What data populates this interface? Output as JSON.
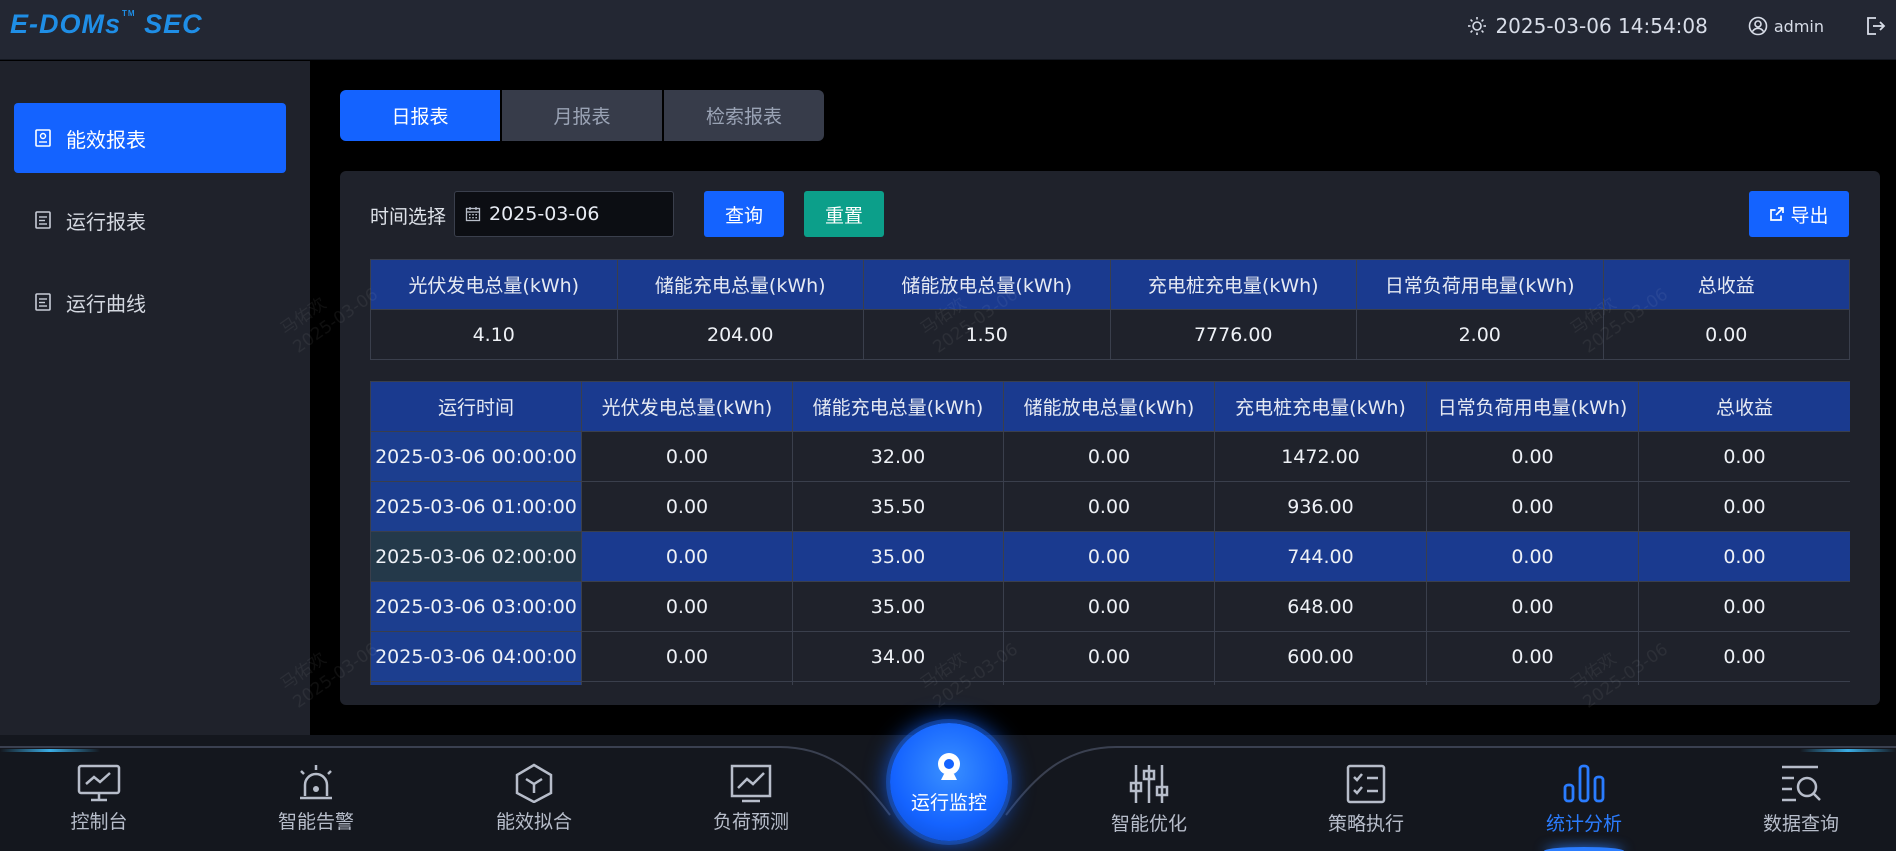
{
  "header": {
    "logo": "E-DOMs",
    "logo_tm": "TM",
    "logo_suffix": "SEC",
    "datetime": "2025-03-06 14:54:08",
    "user": "admin"
  },
  "sidebar": {
    "items": [
      {
        "label": "能效报表"
      },
      {
        "label": "运行报表"
      },
      {
        "label": "运行曲线"
      }
    ]
  },
  "tabs": [
    {
      "label": "日报表"
    },
    {
      "label": "月报表"
    },
    {
      "label": "检索报表"
    }
  ],
  "filter": {
    "label": "时间选择",
    "date_value": "2025-03-06",
    "query_label": "查询",
    "reset_label": "重置",
    "export_label": "导出"
  },
  "summary_table": {
    "headers": [
      "光伏发电总量(kWh)",
      "储能充电总量(kWh)",
      "储能放电总量(kWh)",
      "充电桩充电量(kWh)",
      "日常负荷用电量(kWh)",
      "总收益"
    ],
    "values": [
      "4.10",
      "204.00",
      "1.50",
      "7776.00",
      "2.00",
      "0.00"
    ]
  },
  "detail_table": {
    "headers": [
      "运行时间",
      "光伏发电总量(kWh)",
      "储能充电总量(kWh)",
      "储能放电总量(kWh)",
      "充电桩充电量(kWh)",
      "日常负荷用电量(kWh)",
      "总收益"
    ],
    "rows": [
      [
        "2025-03-06 00:00:00",
        "0.00",
        "32.00",
        "0.00",
        "1472.00",
        "0.00",
        "0.00"
      ],
      [
        "2025-03-06 01:00:00",
        "0.00",
        "35.50",
        "0.00",
        "936.00",
        "0.00",
        "0.00"
      ],
      [
        "2025-03-06 02:00:00",
        "0.00",
        "35.00",
        "0.00",
        "744.00",
        "0.00",
        "0.00"
      ],
      [
        "2025-03-06 03:00:00",
        "0.00",
        "35.00",
        "0.00",
        "648.00",
        "0.00",
        "0.00"
      ],
      [
        "2025-03-06 04:00:00",
        "0.00",
        "34.00",
        "0.00",
        "600.00",
        "0.00",
        "0.00"
      ]
    ]
  },
  "watermark": {
    "name": "马佑欢",
    "date": "2025-03-06"
  },
  "bottom_nav": {
    "items": [
      {
        "label": "控制台",
        "icon": "monitor-icon"
      },
      {
        "label": "智能告警",
        "icon": "alarm-icon"
      },
      {
        "label": "能效拟合",
        "icon": "hexagon-icon"
      },
      {
        "label": "负荷预测",
        "icon": "trend-chart-icon"
      },
      {
        "label": "智能优化",
        "icon": "sliders-icon"
      },
      {
        "label": "策略执行",
        "icon": "checklist-icon"
      },
      {
        "label": "统计分析",
        "icon": "bar-chart-icon"
      },
      {
        "label": "数据查询",
        "icon": "search-list-icon"
      }
    ],
    "center_label": "运行监控"
  },
  "colors": {
    "accent": "#1463ff",
    "reset": "#0c9f8a",
    "table_header": "#1a3a8f"
  }
}
